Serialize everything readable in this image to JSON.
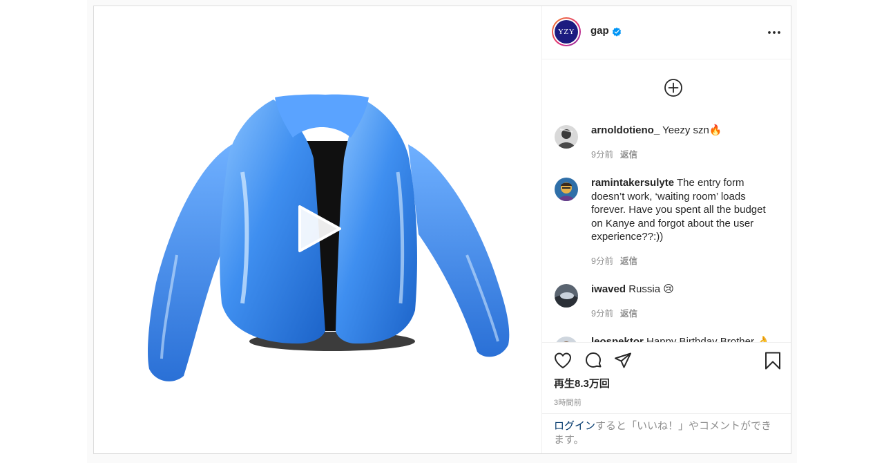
{
  "post": {
    "media": {
      "type": "video",
      "subject": "blue puffer jacket",
      "play_icon": "play-icon"
    },
    "header": {
      "avatar_text": "YZY",
      "username": "gap",
      "verified_icon": "verified-badge-icon",
      "more_icon": "more-options-icon",
      "accent_color": "#0095f6"
    },
    "load_more_icon": "plus-circle-icon",
    "comments": [
      {
        "username": "arnoldotieno_",
        "text": "Yeezy szn🔥",
        "time": "9分前",
        "reply_label": "返信"
      },
      {
        "username": "ramintakersulyte",
        "text": "The entry form doesn’t work, ‘waiting room’ loads forever. Have you spent all the budget on Kanye and forgot about the user experience??:))",
        "time": "9分前",
        "reply_label": "返信"
      },
      {
        "username": "iwaved",
        "text": "Russia 😢",
        "time": "9分前",
        "reply_label": "返信"
      },
      {
        "username": "leospektor",
        "text": "Happy Birthday Brother 👌"
      }
    ],
    "actions": {
      "like_icon": "heart-icon",
      "comment_icon": "comment-icon",
      "share_icon": "paper-plane-icon",
      "save_icon": "bookmark-icon"
    },
    "views": "再生8.3万回",
    "timestamp": "3時間前",
    "login_prompt": {
      "link": "ログイン",
      "text": "すると「いいね！」やコメントができます。"
    }
  }
}
